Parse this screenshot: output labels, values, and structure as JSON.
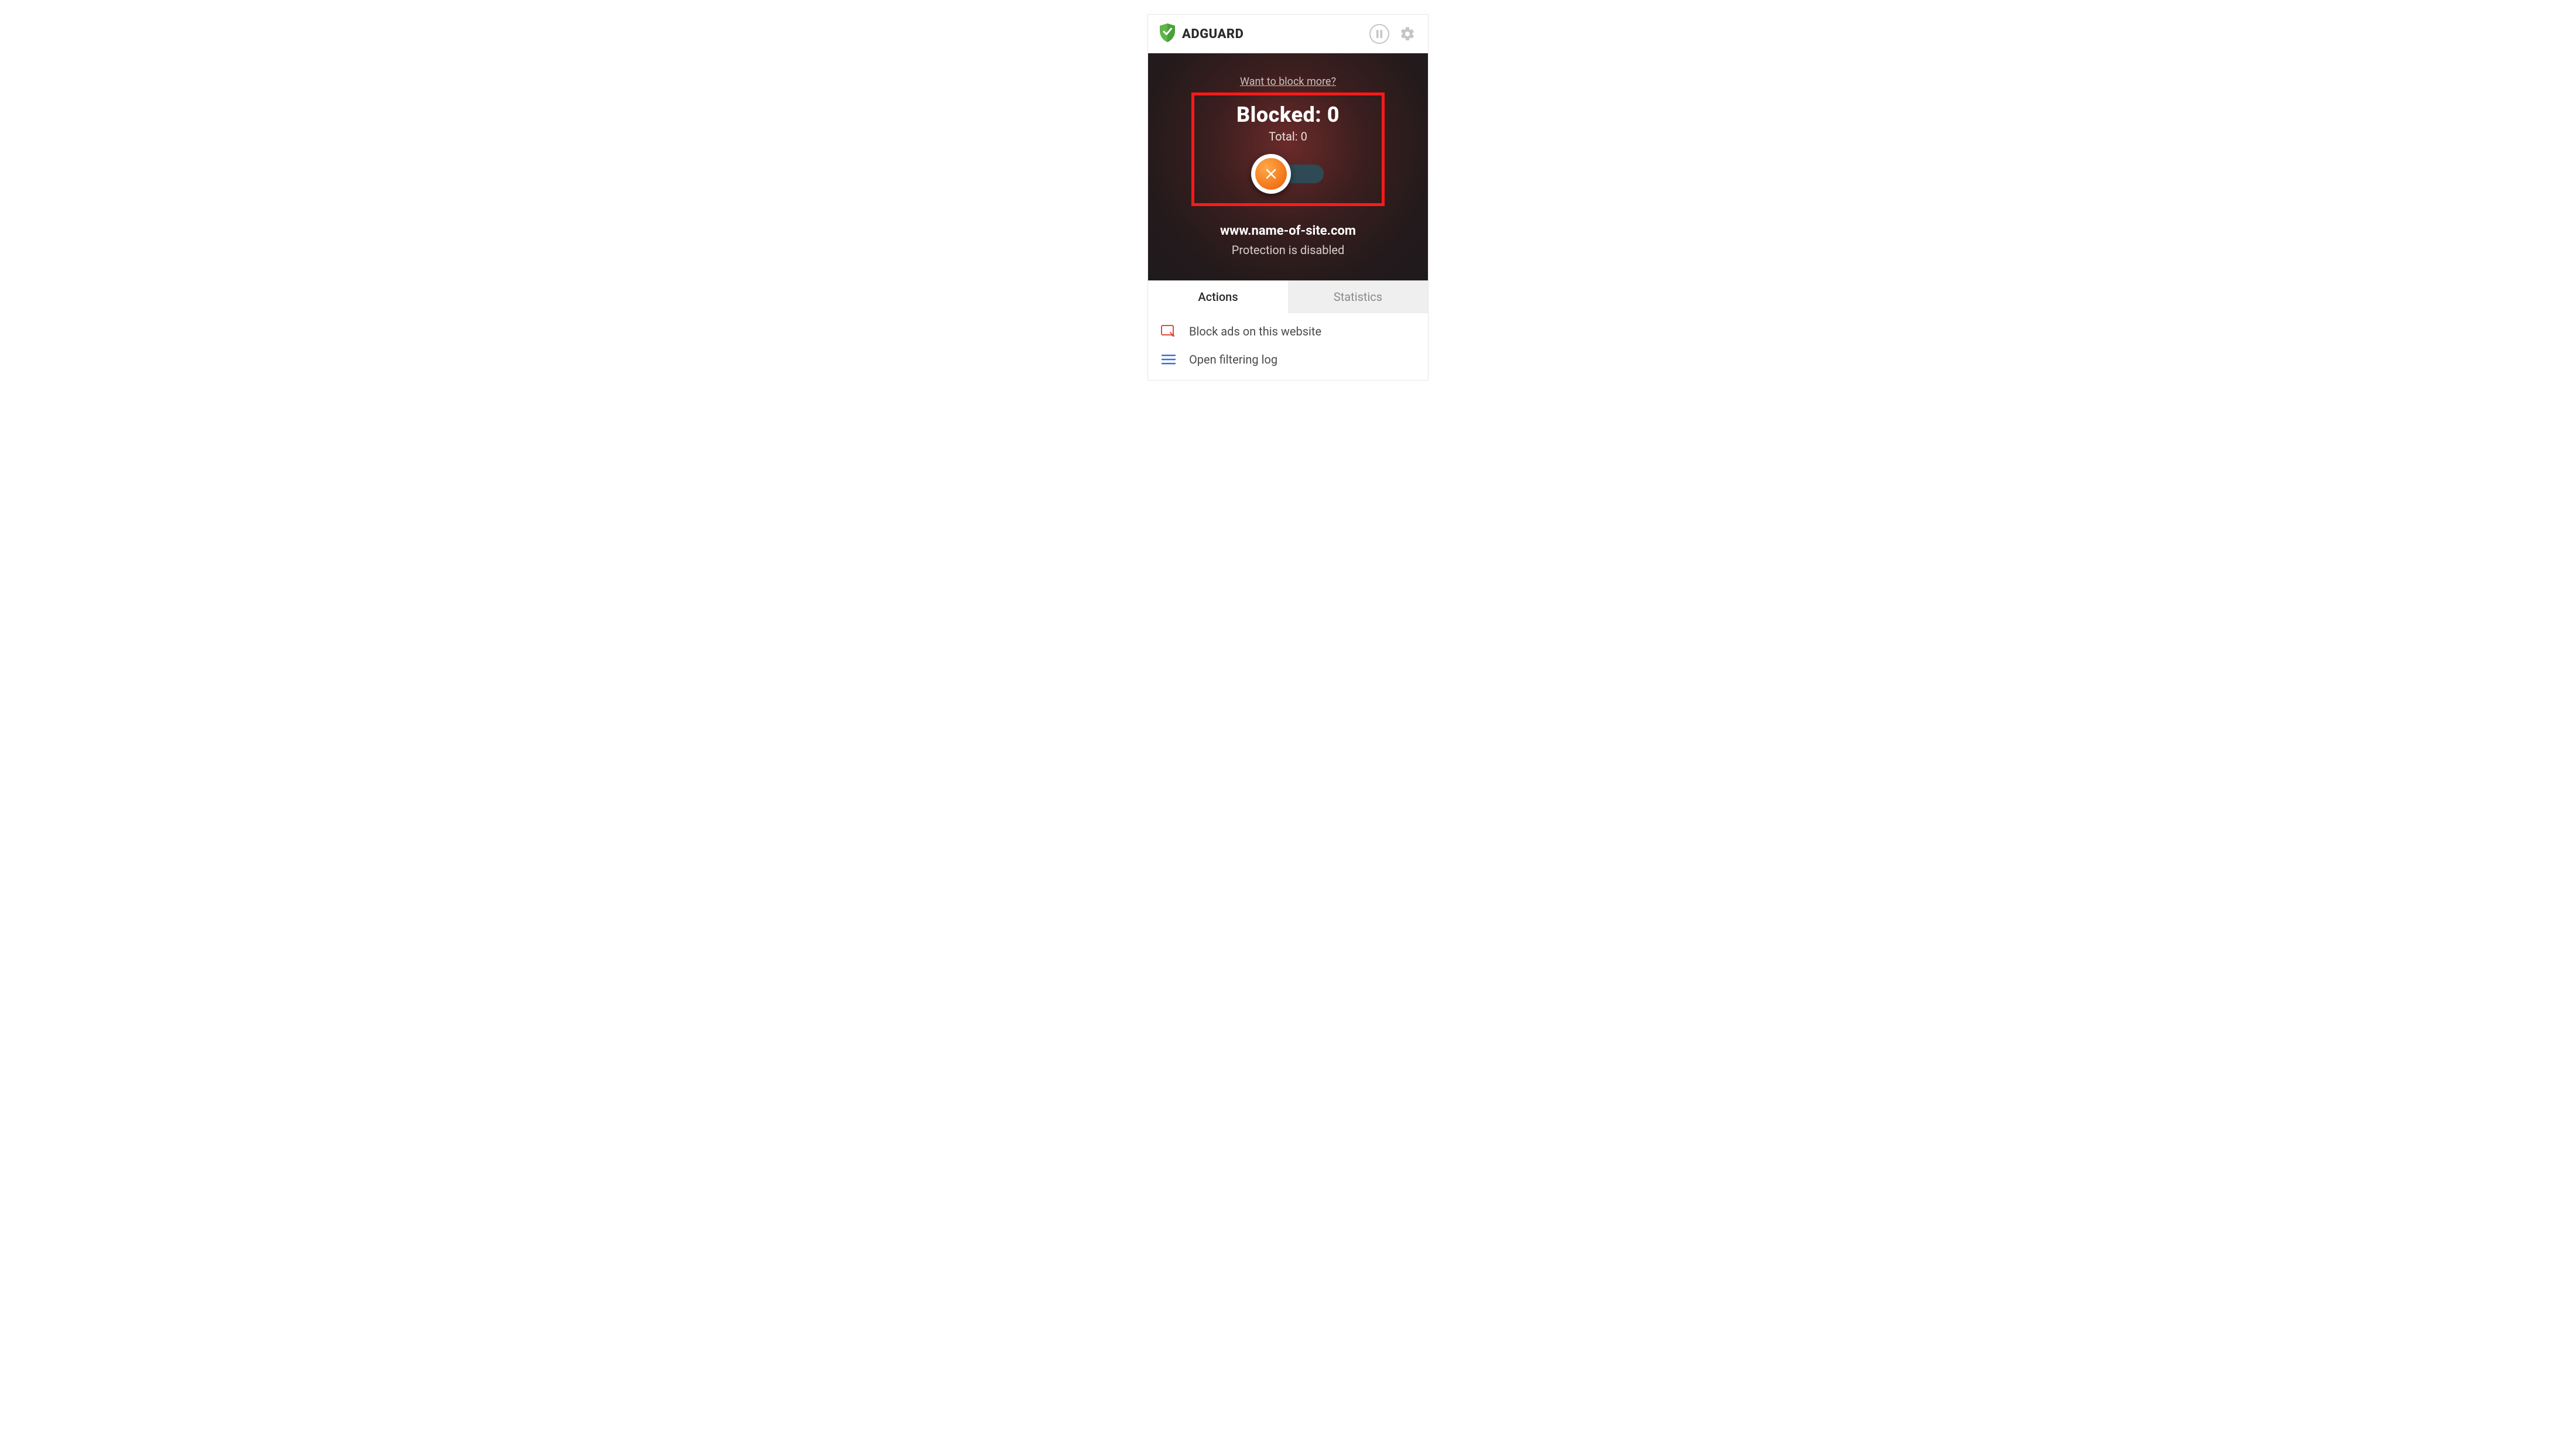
{
  "header": {
    "brand": "ADGUARD"
  },
  "hero": {
    "want_more": "Want to block more?",
    "blocked_label": "Blocked:",
    "blocked_count": "0",
    "total_label": "Total:",
    "total_count": "0",
    "site": "www.name-of-site.com",
    "status": "Protection is disabled"
  },
  "tabs": {
    "actions": "Actions",
    "statistics": "Statistics"
  },
  "actions": {
    "block_ads": "Block ads on this website",
    "open_log": "Open filtering log"
  },
  "colors": {
    "brand_green": "#5fb54a",
    "danger_red": "#e24a3b",
    "link_blue": "#3a6fd8"
  }
}
